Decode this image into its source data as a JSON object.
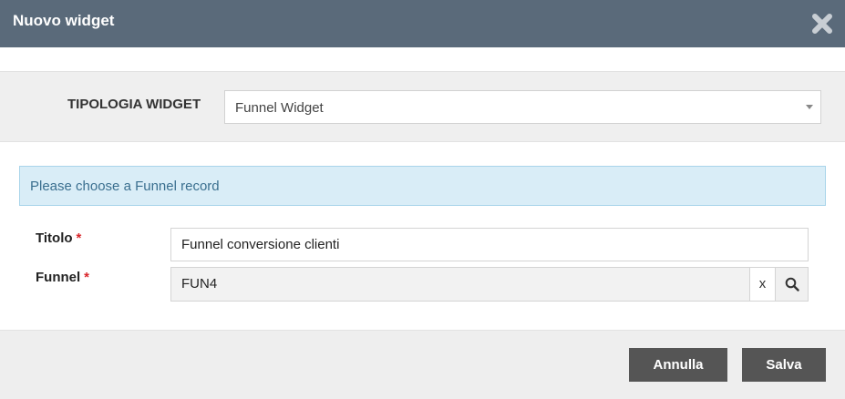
{
  "dialog": {
    "title": "Nuovo widget",
    "close_icon": "close-icon"
  },
  "widget_type": {
    "label": "TIPOLOGIA WIDGET",
    "selected": "Funnel Widget"
  },
  "info": {
    "message": "Please choose a Funnel record"
  },
  "form": {
    "titolo": {
      "label": "Titolo",
      "required_mark": "*",
      "value": "Funnel conversione clienti"
    },
    "funnel": {
      "label": "Funnel",
      "required_mark": "*",
      "value": "FUN4",
      "clear_label": "x",
      "search_icon": "search-icon"
    }
  },
  "footer": {
    "cancel_label": "Annulla",
    "save_label": "Salva"
  },
  "colors": {
    "header_bg": "#5a6a7a",
    "info_bg": "#d9edf7",
    "button_bg": "#555555",
    "required": "#d9262b"
  }
}
